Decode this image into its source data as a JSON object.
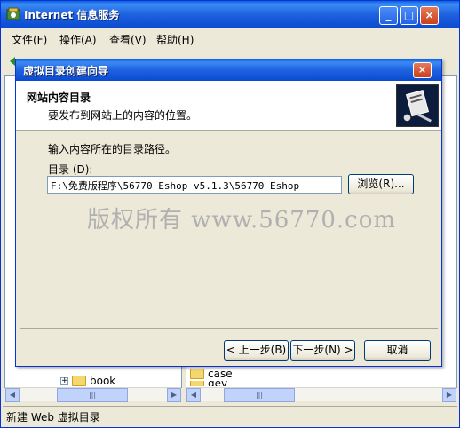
{
  "main_window": {
    "title": "Internet 信息服务",
    "controls": {
      "minimize": "_",
      "maximize": "□",
      "close": "×"
    }
  },
  "menubar": {
    "items": [
      "文件(F)",
      "操作(A)",
      "查看(V)",
      "帮助(H)"
    ]
  },
  "left_pane": {
    "tree_items": [
      "book"
    ]
  },
  "right_pane": {
    "items": [
      "case",
      "dev"
    ]
  },
  "statusbar": {
    "text": "新建 Web 虚拟目录"
  },
  "dialog": {
    "title": "虚拟目录创建向导",
    "close": "×",
    "header_title": "网站内容目录",
    "header_subtitle": "要发布到网站上的内容的位置。",
    "prompt": "输入内容所在的目录路径。",
    "dir_label": "目录 (D):",
    "dir_value": "F:\\免费版程序\\56770 Eshop v5.1.3\\56770 Eshop",
    "browse_label": "浏览(R)...",
    "back_label": "< 上一步(B)",
    "next_label": "下一步(N) >",
    "cancel_label": "取消"
  },
  "watermark": "版权所有 www.56770.com",
  "colors": {
    "title_bar": "#1f62e0",
    "window_bg": "#ece9d8",
    "folder": "#f5d76e"
  },
  "icons": [
    "iis-app-icon",
    "folder-icon",
    "wizard-icon"
  ]
}
